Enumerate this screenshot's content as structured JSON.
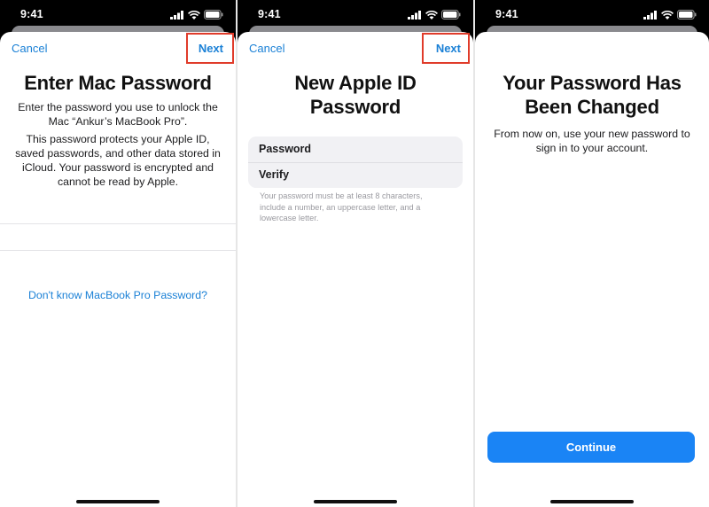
{
  "status_time": "9:41",
  "colors": {
    "accent": "#1a80d6",
    "button": "#1a84f5",
    "highlight": "#e03b2a"
  },
  "icons": [
    "signal-icon",
    "wifi-icon",
    "battery-icon"
  ],
  "screen1": {
    "cancel": "Cancel",
    "next": "Next",
    "title": "Enter Mac Password",
    "line1": "Enter the password you use to unlock the",
    "line2": "Mac “Ankur’s MacBook Pro”.",
    "p2_l1": "This password protects your Apple ID,",
    "p2_l2": "saved passwords, and other data stored in",
    "p2_l3": "iCloud. Your password is encrypted and",
    "p2_l4": "cannot be read by Apple.",
    "link": "Don't know MacBook Pro Password?"
  },
  "screen2": {
    "cancel": "Cancel",
    "next": "Next",
    "title_l1": "New Apple ID",
    "title_l2": "Password",
    "field1": "Password",
    "field2": "Verify",
    "hint_l1": "Your password must be at least 8 characters,",
    "hint_l2": "include a number, an uppercase letter, and a",
    "hint_l3": "lowercase letter."
  },
  "screen3": {
    "title_l1": "Your Password Has",
    "title_l2": "Been Changed",
    "text_l1": "From now on, use your new password to",
    "text_l2": "sign in to your account.",
    "button": "Continue"
  }
}
